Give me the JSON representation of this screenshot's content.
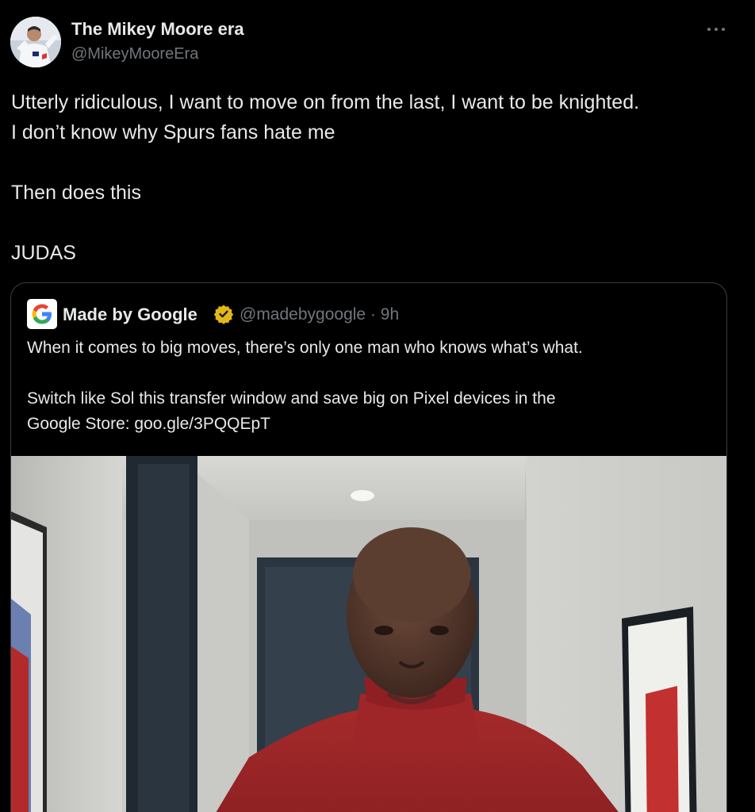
{
  "tweet": {
    "author_name": "The Mikey Moore era",
    "author_handle": "@MikeyMooreEra",
    "text_lines": [
      "Utterly ridiculous, I want to move on from the last, I want to be knighted.",
      "I don’t know why Spurs fans hate me",
      "Then does this",
      "JUDAS"
    ],
    "more_icon": "more-horizontal-icon"
  },
  "quote": {
    "author_name": "Made by Google",
    "author_handle": "@madebygoogle",
    "separator": "·",
    "time": "9h",
    "verified_icon": "gold-verified-badge-icon",
    "logo_icon": "google-g-logo-icon",
    "text_lines": [
      "When it comes to big moves, there’s only one man who knows what’s what.",
      "Switch like Sol this transfer window and save big on Pixel devices in the",
      "Google Store: goo.gle/3PQQEpT"
    ],
    "media": "video-thumbnail"
  },
  "colors": {
    "background": "#000000",
    "text_primary": "#e7e9ea",
    "text_secondary": "#71767b",
    "border": "#3a3d41",
    "verified_gold": "#e2b719"
  }
}
